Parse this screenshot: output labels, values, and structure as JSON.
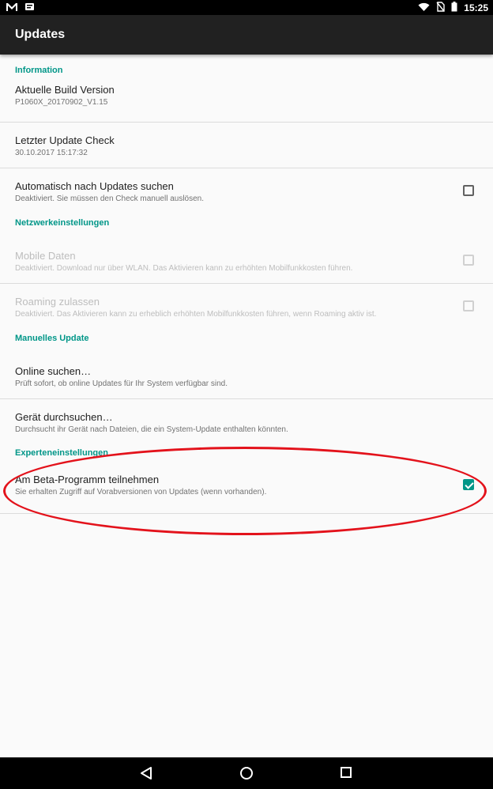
{
  "status_bar": {
    "time": "15:25",
    "icons": [
      "gmail-icon",
      "message-icon",
      "wifi-icon",
      "no-sim-icon",
      "battery-icon"
    ]
  },
  "app_bar": {
    "title": "Updates"
  },
  "sections": {
    "information": {
      "header": "Information",
      "build": {
        "title": "Aktuelle Build Version",
        "summary": "P1060X_20170902_V1.15"
      },
      "last_check": {
        "title": "Letzter Update Check",
        "summary": "30.10.2017 15:17:32"
      },
      "auto_check": {
        "title": "Automatisch nach Updates suchen",
        "summary": "Deaktiviert. Sie müssen den Check manuell auslösen.",
        "checked": false
      }
    },
    "network": {
      "header": "Netzwerkeinstellungen",
      "mobile_data": {
        "title": "Mobile Daten",
        "summary": "Deaktiviert. Download nur über WLAN. Das Aktivieren kann zu erhöhten Mobilfunkkosten führen.",
        "checked": false,
        "enabled": false
      },
      "roaming": {
        "title": "Roaming zulassen",
        "summary": "Deaktiviert. Das Aktivieren kann zu erheblich erhöhten Mobilfunkkosten führen, wenn Roaming aktiv ist.",
        "checked": false,
        "enabled": false
      }
    },
    "manual": {
      "header": "Manuelles Update",
      "online": {
        "title": "Online suchen…",
        "summary": "Prüft sofort, ob online Updates für Ihr System verfügbar sind."
      },
      "device": {
        "title": "Gerät durchsuchen…",
        "summary": "Durchsucht ihr Gerät nach Dateien, die ein System-Update enthalten könnten."
      }
    },
    "expert": {
      "header": "Experteneinstellungen",
      "beta": {
        "title": "Am Beta-Programm teilnehmen",
        "summary": "Sie erhalten Zugriff auf Vorabversionen von Updates (wenn vorhanden).",
        "checked": true
      }
    }
  },
  "nav_bar": {
    "buttons": [
      "back-icon",
      "home-icon",
      "recents-icon"
    ]
  },
  "colors": {
    "accent": "#009688",
    "app_bar": "#212121",
    "highlight": "#e3121b"
  }
}
